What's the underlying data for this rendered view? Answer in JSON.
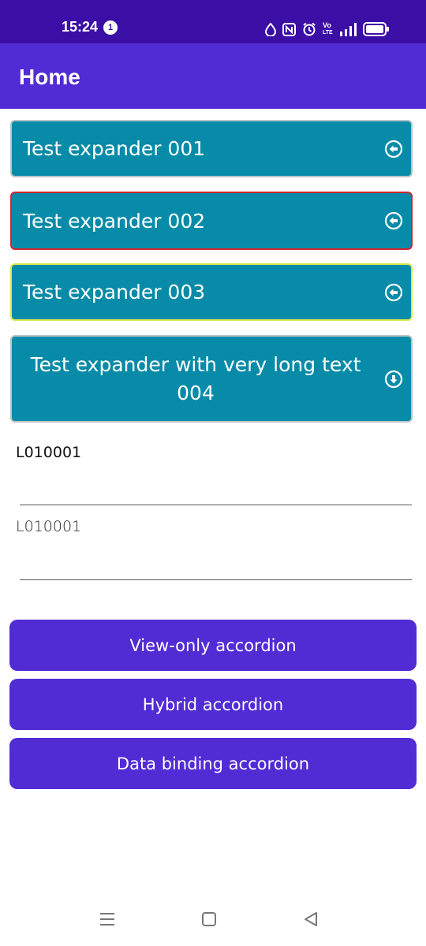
{
  "status_bar": {
    "time": "15:24",
    "notification_count": "1",
    "icons": [
      "water-drop-icon",
      "nfc-icon",
      "alarm-clock-icon",
      "volte-icon",
      "signal-icon",
      "battery-icon"
    ],
    "volte_label_top": "Vo",
    "volte_label_bottom": "LTE",
    "background_color": "#3b0ea6"
  },
  "app_bar": {
    "title": "Home",
    "background_color": "#512bd4"
  },
  "expanders": [
    {
      "label": "Test expander 001",
      "icon": "arrow-left-circle-icon",
      "border_color": "#b7c4c9"
    },
    {
      "label": "Test expander 002",
      "icon": "arrow-left-circle-icon",
      "border_color": "#d1252d"
    },
    {
      "label": "Test expander 003",
      "icon": "arrow-left-circle-icon",
      "border_color": "#dbe84a"
    },
    {
      "label": "Test expander with very long text 004",
      "icon": "arrow-down-circle-icon",
      "border_color": "#b7c4c9"
    }
  ],
  "expander_color": "#078ba8",
  "fields": [
    {
      "value": "L010001"
    },
    {
      "value": "L010001"
    }
  ],
  "buttons": [
    {
      "label": "View-only accordion"
    },
    {
      "label": "Hybrid accordion"
    },
    {
      "label": "Data binding accordion"
    }
  ],
  "button_color": "#512bd4",
  "nav_bar": {
    "icons": [
      "menu-icon",
      "home-square-icon",
      "back-triangle-icon"
    ]
  }
}
